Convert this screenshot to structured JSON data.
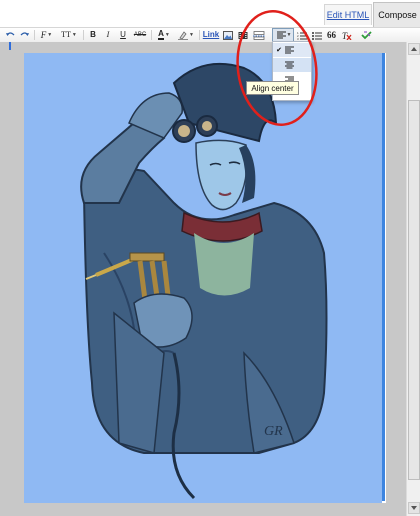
{
  "tabs": {
    "edit_html": "Edit HTML",
    "compose": "Compose"
  },
  "toolbar": {
    "buttons": [
      {
        "icon": "undo-icon"
      },
      {
        "icon": "redo-icon"
      },
      {
        "icon": "font-family-icon",
        "glyph": "F"
      },
      {
        "icon": "font-size-icon",
        "glyph": "TT"
      },
      {
        "icon": "bold-icon",
        "glyph": "B"
      },
      {
        "icon": "italic-icon",
        "glyph": "I"
      },
      {
        "icon": "underline-icon",
        "glyph": "U"
      },
      {
        "icon": "strikethrough-icon",
        "glyph": "ABC"
      },
      {
        "icon": "text-color-icon",
        "glyph": "A"
      },
      {
        "icon": "highlight-color-icon"
      },
      {
        "icon": "image-icon"
      },
      {
        "icon": "video-icon"
      },
      {
        "icon": "jump-break-icon"
      },
      {
        "icon": "numbered-list-icon"
      },
      {
        "icon": "bullet-list-icon"
      },
      {
        "icon": "blockquote-icon",
        "glyph": "66"
      },
      {
        "icon": "remove-formatting-icon"
      },
      {
        "icon": "spellcheck-icon"
      }
    ],
    "link_label": "Link",
    "alignment": {
      "current": "left",
      "tooltip": "Align center",
      "options": [
        "left",
        "center",
        "right"
      ]
    }
  },
  "colors": {
    "canvas_bg": "#8fb9f3",
    "frame": "#c8c8c8",
    "accent": "#3d85e0",
    "annotation": "#e0201b"
  },
  "canvas": {
    "signature": "GR"
  }
}
